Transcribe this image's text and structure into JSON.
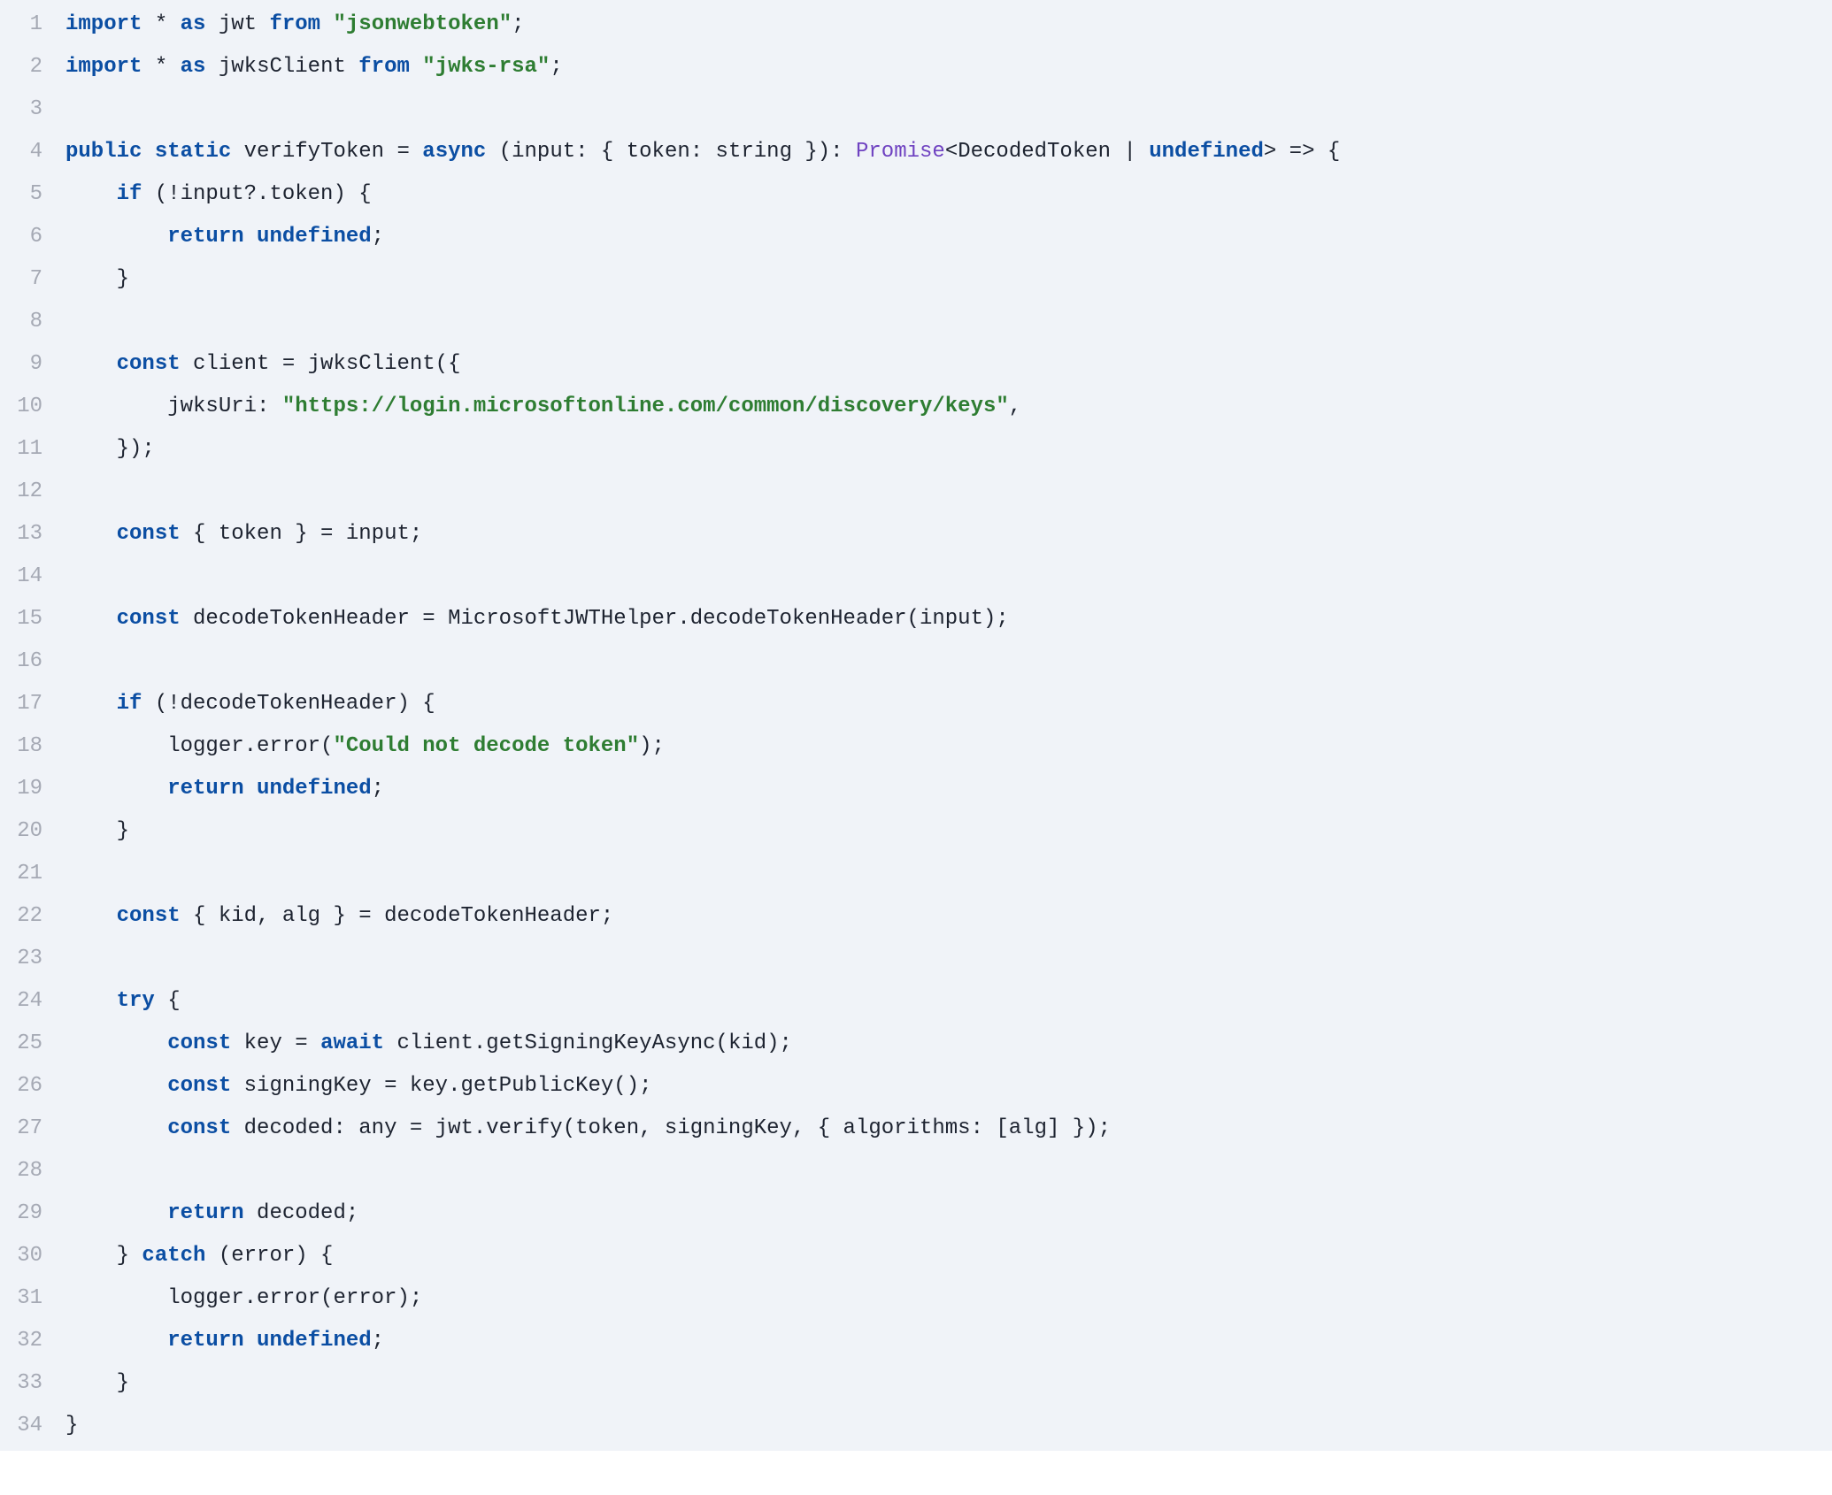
{
  "code": {
    "language": "typescript",
    "theme": {
      "background": "#f0f3f8",
      "gutter_text": "#a5a9b4",
      "text": "#1d2330",
      "keyword": "#0b4ea3",
      "string": "#2e7d32",
      "type": "#6f42c1"
    },
    "lines": [
      {
        "n": 1,
        "t": [
          {
            "c": "kw",
            "s": "import"
          },
          {
            "c": "plain",
            "s": " * "
          },
          {
            "c": "kw",
            "s": "as"
          },
          {
            "c": "plain",
            "s": " jwt "
          },
          {
            "c": "kw",
            "s": "from"
          },
          {
            "c": "plain",
            "s": " "
          },
          {
            "c": "str",
            "s": "\"jsonwebtoken\""
          },
          {
            "c": "plain",
            "s": ";"
          }
        ]
      },
      {
        "n": 2,
        "t": [
          {
            "c": "kw",
            "s": "import"
          },
          {
            "c": "plain",
            "s": " * "
          },
          {
            "c": "kw",
            "s": "as"
          },
          {
            "c": "plain",
            "s": " jwksClient "
          },
          {
            "c": "kw",
            "s": "from"
          },
          {
            "c": "plain",
            "s": " "
          },
          {
            "c": "str",
            "s": "\"jwks-rsa\""
          },
          {
            "c": "plain",
            "s": ";"
          }
        ]
      },
      {
        "n": 3,
        "t": [
          {
            "c": "plain",
            "s": ""
          }
        ]
      },
      {
        "n": 4,
        "t": [
          {
            "c": "kw",
            "s": "public"
          },
          {
            "c": "plain",
            "s": " "
          },
          {
            "c": "kw",
            "s": "static"
          },
          {
            "c": "plain",
            "s": " verifyToken = "
          },
          {
            "c": "kw",
            "s": "async"
          },
          {
            "c": "plain",
            "s": " (input: { token: string }): "
          },
          {
            "c": "type",
            "s": "Promise"
          },
          {
            "c": "plain",
            "s": "<DecodedToken | "
          },
          {
            "c": "kw",
            "s": "undefined"
          },
          {
            "c": "plain",
            "s": "> => {"
          }
        ]
      },
      {
        "n": 5,
        "t": [
          {
            "c": "plain",
            "s": "    "
          },
          {
            "c": "kw",
            "s": "if"
          },
          {
            "c": "plain",
            "s": " (!input?.token) {"
          }
        ]
      },
      {
        "n": 6,
        "t": [
          {
            "c": "plain",
            "s": "        "
          },
          {
            "c": "kw",
            "s": "return"
          },
          {
            "c": "plain",
            "s": " "
          },
          {
            "c": "kw",
            "s": "undefined"
          },
          {
            "c": "plain",
            "s": ";"
          }
        ]
      },
      {
        "n": 7,
        "t": [
          {
            "c": "plain",
            "s": "    }"
          }
        ]
      },
      {
        "n": 8,
        "t": [
          {
            "c": "plain",
            "s": ""
          }
        ]
      },
      {
        "n": 9,
        "t": [
          {
            "c": "plain",
            "s": "    "
          },
          {
            "c": "kw",
            "s": "const"
          },
          {
            "c": "plain",
            "s": " client = jwksClient({"
          }
        ]
      },
      {
        "n": 10,
        "t": [
          {
            "c": "plain",
            "s": "        jwksUri: "
          },
          {
            "c": "str",
            "s": "\"https://login.microsoftonline.com/common/discovery/keys\""
          },
          {
            "c": "plain",
            "s": ","
          }
        ]
      },
      {
        "n": 11,
        "t": [
          {
            "c": "plain",
            "s": "    });"
          }
        ]
      },
      {
        "n": 12,
        "t": [
          {
            "c": "plain",
            "s": ""
          }
        ]
      },
      {
        "n": 13,
        "t": [
          {
            "c": "plain",
            "s": "    "
          },
          {
            "c": "kw",
            "s": "const"
          },
          {
            "c": "plain",
            "s": " { token } = input;"
          }
        ]
      },
      {
        "n": 14,
        "t": [
          {
            "c": "plain",
            "s": ""
          }
        ]
      },
      {
        "n": 15,
        "t": [
          {
            "c": "plain",
            "s": "    "
          },
          {
            "c": "kw",
            "s": "const"
          },
          {
            "c": "plain",
            "s": " decodeTokenHeader = MicrosoftJWTHelper.decodeTokenHeader(input);"
          }
        ]
      },
      {
        "n": 16,
        "t": [
          {
            "c": "plain",
            "s": ""
          }
        ]
      },
      {
        "n": 17,
        "t": [
          {
            "c": "plain",
            "s": "    "
          },
          {
            "c": "kw",
            "s": "if"
          },
          {
            "c": "plain",
            "s": " (!decodeTokenHeader) {"
          }
        ]
      },
      {
        "n": 18,
        "t": [
          {
            "c": "plain",
            "s": "        logger.error("
          },
          {
            "c": "str",
            "s": "\"Could not decode token\""
          },
          {
            "c": "plain",
            "s": ");"
          }
        ]
      },
      {
        "n": 19,
        "t": [
          {
            "c": "plain",
            "s": "        "
          },
          {
            "c": "kw",
            "s": "return"
          },
          {
            "c": "plain",
            "s": " "
          },
          {
            "c": "kw",
            "s": "undefined"
          },
          {
            "c": "plain",
            "s": ";"
          }
        ]
      },
      {
        "n": 20,
        "t": [
          {
            "c": "plain",
            "s": "    }"
          }
        ]
      },
      {
        "n": 21,
        "t": [
          {
            "c": "plain",
            "s": ""
          }
        ]
      },
      {
        "n": 22,
        "t": [
          {
            "c": "plain",
            "s": "    "
          },
          {
            "c": "kw",
            "s": "const"
          },
          {
            "c": "plain",
            "s": " { kid, alg } = decodeTokenHeader;"
          }
        ]
      },
      {
        "n": 23,
        "t": [
          {
            "c": "plain",
            "s": ""
          }
        ]
      },
      {
        "n": 24,
        "t": [
          {
            "c": "plain",
            "s": "    "
          },
          {
            "c": "kw",
            "s": "try"
          },
          {
            "c": "plain",
            "s": " {"
          }
        ]
      },
      {
        "n": 25,
        "t": [
          {
            "c": "plain",
            "s": "        "
          },
          {
            "c": "kw",
            "s": "const"
          },
          {
            "c": "plain",
            "s": " key = "
          },
          {
            "c": "kw",
            "s": "await"
          },
          {
            "c": "plain",
            "s": " client.getSigningKeyAsync(kid);"
          }
        ]
      },
      {
        "n": 26,
        "t": [
          {
            "c": "plain",
            "s": "        "
          },
          {
            "c": "kw",
            "s": "const"
          },
          {
            "c": "plain",
            "s": " signingKey = key.getPublicKey();"
          }
        ]
      },
      {
        "n": 27,
        "t": [
          {
            "c": "plain",
            "s": "        "
          },
          {
            "c": "kw",
            "s": "const"
          },
          {
            "c": "plain",
            "s": " decoded: any = jwt.verify(token, signingKey, { algorithms: [alg] });"
          }
        ]
      },
      {
        "n": 28,
        "t": [
          {
            "c": "plain",
            "s": ""
          }
        ]
      },
      {
        "n": 29,
        "t": [
          {
            "c": "plain",
            "s": "        "
          },
          {
            "c": "kw",
            "s": "return"
          },
          {
            "c": "plain",
            "s": " decoded;"
          }
        ]
      },
      {
        "n": 30,
        "t": [
          {
            "c": "plain",
            "s": "    } "
          },
          {
            "c": "kw",
            "s": "catch"
          },
          {
            "c": "plain",
            "s": " (error) {"
          }
        ]
      },
      {
        "n": 31,
        "t": [
          {
            "c": "plain",
            "s": "        logger.error(error);"
          }
        ]
      },
      {
        "n": 32,
        "t": [
          {
            "c": "plain",
            "s": "        "
          },
          {
            "c": "kw",
            "s": "return"
          },
          {
            "c": "plain",
            "s": " "
          },
          {
            "c": "kw",
            "s": "undefined"
          },
          {
            "c": "plain",
            "s": ";"
          }
        ]
      },
      {
        "n": 33,
        "t": [
          {
            "c": "plain",
            "s": "    }"
          }
        ]
      },
      {
        "n": 34,
        "t": [
          {
            "c": "plain",
            "s": "}"
          }
        ]
      }
    ]
  }
}
